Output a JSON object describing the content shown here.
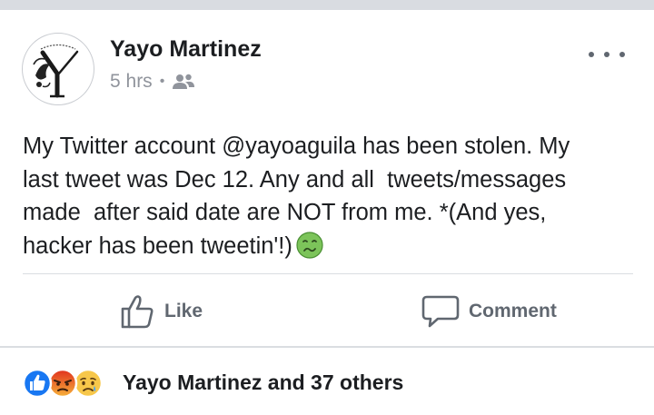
{
  "post": {
    "author": "Yayo Martinez",
    "time": "5 hrs",
    "separator": "•",
    "audience_icon": "friends-icon",
    "avatar_icon": "monogram-y-logo",
    "more_icon": "more-options-icon",
    "text": "My Twitter account @yayoaguila has been stolen. My\nlast tweet was Dec 12. Any and all  tweets/messages\nmade  after said date are NOT from me. *(And yes,\nhacker has been tweetin'!)",
    "trailing_emoji": "nauseated-face-icon"
  },
  "actions": {
    "like_label": "Like",
    "like_icon": "thumbs-up-outline-icon",
    "comment_label": "Comment",
    "comment_icon": "speech-bubble-icon"
  },
  "reactions": {
    "icons": [
      "like-reaction-icon",
      "angry-reaction-icon",
      "sad-reaction-icon"
    ],
    "summary": "Yayo Martinez and 37 others"
  },
  "colors": {
    "text": "#1c1e21",
    "muted": "#90949c",
    "action": "#606770",
    "like_blue": "#1877f2",
    "angry_red": "#e9710f",
    "divider": "#dadde1"
  }
}
